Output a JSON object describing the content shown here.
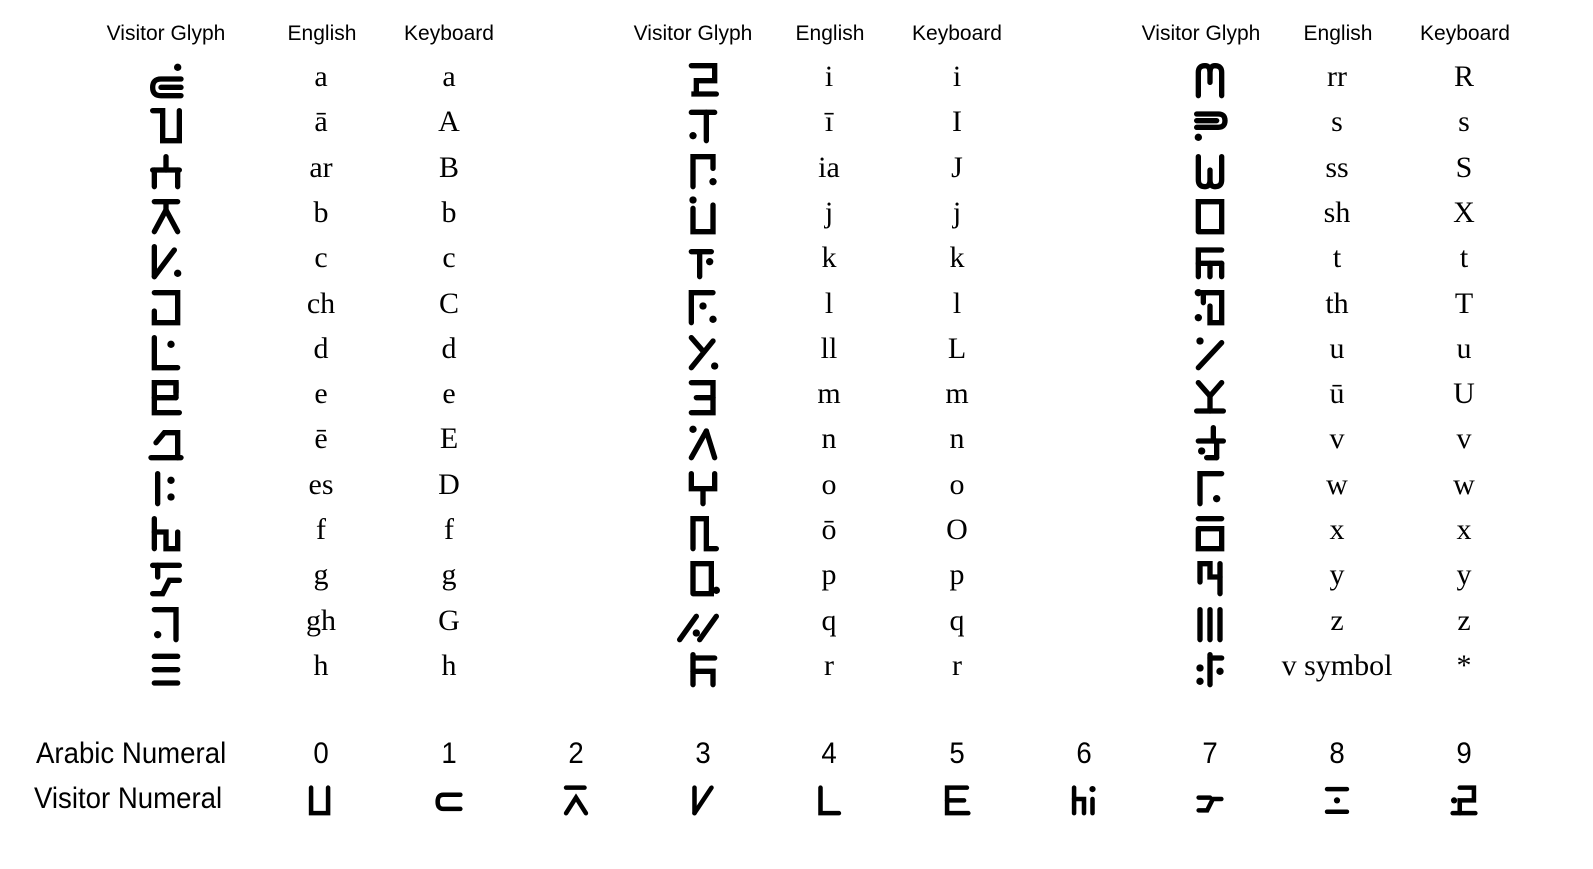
{
  "headers": {
    "glyph": "Visitor Glyph",
    "english": "English",
    "keyboard": "Keyboard"
  },
  "columns": [
    {
      "rows": [
        {
          "glyph": "a-glyph",
          "english": "a",
          "keyboard": "a"
        },
        {
          "glyph": "a-long-glyph",
          "english": "ā",
          "keyboard": "A"
        },
        {
          "glyph": "ar-glyph",
          "english": "ar",
          "keyboard": "B"
        },
        {
          "glyph": "b-glyph",
          "english": "b",
          "keyboard": "b"
        },
        {
          "glyph": "c-glyph",
          "english": "c",
          "keyboard": "c"
        },
        {
          "glyph": "ch-glyph",
          "english": "ch",
          "keyboard": "C"
        },
        {
          "glyph": "d-glyph",
          "english": "d",
          "keyboard": "d"
        },
        {
          "glyph": "e-glyph",
          "english": "e",
          "keyboard": "e"
        },
        {
          "glyph": "e-long-glyph",
          "english": "ē",
          "keyboard": "E"
        },
        {
          "glyph": "es-glyph",
          "english": "es",
          "keyboard": "D"
        },
        {
          "glyph": "f-glyph",
          "english": "f",
          "keyboard": "f"
        },
        {
          "glyph": "g-glyph",
          "english": "g",
          "keyboard": "g"
        },
        {
          "glyph": "gh-glyph",
          "english": "gh",
          "keyboard": "G"
        },
        {
          "glyph": "h-glyph",
          "english": "h",
          "keyboard": "h"
        }
      ]
    },
    {
      "rows": [
        {
          "glyph": "i-glyph",
          "english": "i",
          "keyboard": "i"
        },
        {
          "glyph": "i-long-glyph",
          "english": "ī",
          "keyboard": "I"
        },
        {
          "glyph": "ia-glyph",
          "english": "ia",
          "keyboard": "J"
        },
        {
          "glyph": "j-glyph",
          "english": "j",
          "keyboard": "j"
        },
        {
          "glyph": "k-glyph",
          "english": "k",
          "keyboard": "k"
        },
        {
          "glyph": "l-glyph",
          "english": "l",
          "keyboard": "l"
        },
        {
          "glyph": "ll-glyph",
          "english": "ll",
          "keyboard": "L"
        },
        {
          "glyph": "m-glyph",
          "english": "m",
          "keyboard": "m"
        },
        {
          "glyph": "n-glyph",
          "english": "n",
          "keyboard": "n"
        },
        {
          "glyph": "o-glyph",
          "english": "o",
          "keyboard": "o"
        },
        {
          "glyph": "o-long-glyph",
          "english": "ō",
          "keyboard": "O"
        },
        {
          "glyph": "p-glyph",
          "english": "p",
          "keyboard": "p"
        },
        {
          "glyph": "q-glyph",
          "english": "q",
          "keyboard": "q"
        },
        {
          "glyph": "r-glyph",
          "english": "r",
          "keyboard": "r"
        }
      ]
    },
    {
      "rows": [
        {
          "glyph": "rr-glyph",
          "english": "rr",
          "keyboard": "R"
        },
        {
          "glyph": "s-glyph",
          "english": "s",
          "keyboard": "s"
        },
        {
          "glyph": "ss-glyph",
          "english": "ss",
          "keyboard": "S"
        },
        {
          "glyph": "sh-glyph",
          "english": "sh",
          "keyboard": "X"
        },
        {
          "glyph": "t-glyph",
          "english": "t",
          "keyboard": "t"
        },
        {
          "glyph": "th-glyph",
          "english": "th",
          "keyboard": "T"
        },
        {
          "glyph": "u-glyph",
          "english": "u",
          "keyboard": "u"
        },
        {
          "glyph": "u-long-glyph",
          "english": "ū",
          "keyboard": "U"
        },
        {
          "glyph": "v-glyph",
          "english": "v",
          "keyboard": "v"
        },
        {
          "glyph": "w-glyph",
          "english": "w",
          "keyboard": "w"
        },
        {
          "glyph": "x-glyph",
          "english": "x",
          "keyboard": "x"
        },
        {
          "glyph": "y-glyph",
          "english": "y",
          "keyboard": "y"
        },
        {
          "glyph": "z-glyph",
          "english": "z",
          "keyboard": "z"
        },
        {
          "glyph": "v-symbol-glyph",
          "english": "v symbol",
          "keyboard": "*"
        }
      ]
    }
  ],
  "numerals": {
    "arabic_label": "Arabic Numeral",
    "visitor_label": "Visitor Numeral",
    "arabic": [
      "0",
      "1",
      "2",
      "3",
      "4",
      "5",
      "6",
      "7",
      "8",
      "9"
    ],
    "visitor": [
      "num0-glyph",
      "num1-glyph",
      "num2-glyph",
      "num3-glyph",
      "num4-glyph",
      "num5-glyph",
      "num6-glyph",
      "num7-glyph",
      "num8-glyph",
      "num9-glyph"
    ]
  }
}
